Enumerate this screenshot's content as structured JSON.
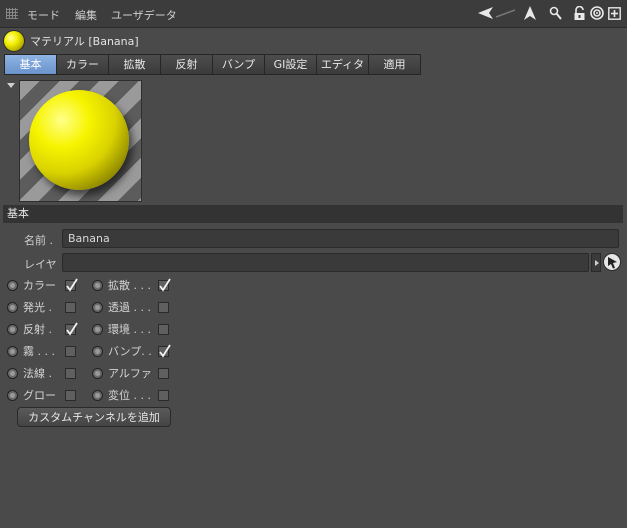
{
  "menubar": {
    "items": [
      "モード",
      "編集",
      "ユーザデータ"
    ],
    "icons": [
      "back-arrow-icon",
      "forward-arrow-icon",
      "up-arrow-icon",
      "search-icon",
      "lock-icon",
      "target-icon",
      "new-panel-icon"
    ]
  },
  "material": {
    "title": "マテリアル [Banana]",
    "color": "#f2f000"
  },
  "tabs": [
    {
      "label": "基本",
      "active": true
    },
    {
      "label": "カラー",
      "active": false
    },
    {
      "label": "拡散",
      "active": false
    },
    {
      "label": "反射",
      "active": false
    },
    {
      "label": "バンプ",
      "active": false
    },
    {
      "label": "GI設定",
      "active": false
    },
    {
      "label": "エディタ",
      "active": false
    },
    {
      "label": "適用",
      "active": false
    }
  ],
  "section": {
    "title": "基本"
  },
  "fields": {
    "name_label": "名前 .",
    "name_value": "Banana",
    "layer_label": "レイヤ",
    "layer_value": ""
  },
  "channels_left": [
    {
      "label": "カラー",
      "checked": true
    },
    {
      "label": "発光 .",
      "checked": false
    },
    {
      "label": "反射 .",
      "checked": true
    },
    {
      "label": "霧 . . .",
      "checked": false
    },
    {
      "label": "法線 .",
      "checked": false
    },
    {
      "label": "グロー",
      "checked": false
    }
  ],
  "channels_right": [
    {
      "label": "拡散 . . .",
      "checked": true
    },
    {
      "label": "透過 . . .",
      "checked": false
    },
    {
      "label": "環境 . . .",
      "checked": false
    },
    {
      "label": "バンプ. .",
      "checked": true
    },
    {
      "label": "アルファ",
      "checked": false
    },
    {
      "label": "変位 . . .",
      "checked": false
    }
  ],
  "buttons": {
    "add_custom_channel": "カスタムチャンネルを追加"
  },
  "colors": {
    "accent_tab": "#7aa2d8",
    "panel_bg": "#4a4a4a"
  }
}
